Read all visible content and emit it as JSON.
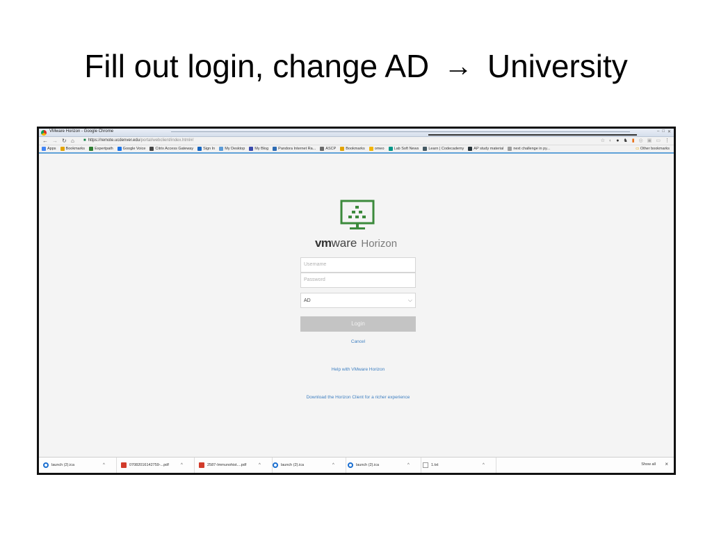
{
  "slide": {
    "title_before": "Fill out login, change AD",
    "title_arrow": "→",
    "title_after": "University"
  },
  "browser": {
    "window_title": "VMware Horizon - Google Chrome",
    "url_host": "https://remote.ucdenver.edu",
    "url_path": "/portal/webclient/index.html#/",
    "bookmarks": [
      {
        "label": "Apps",
        "color": "#4285f4"
      },
      {
        "label": "Bookmarks",
        "color": "#e2a300"
      },
      {
        "label": "Expertpath",
        "color": "#2e7d32"
      },
      {
        "label": "Google Voice",
        "color": "#1a73e8"
      },
      {
        "label": "Citrix Access Gateway",
        "color": "#444444"
      },
      {
        "label": "Sign In",
        "color": "#1565c0"
      },
      {
        "label": "My Desktop",
        "color": "#5c9bd6"
      },
      {
        "label": "My Blog",
        "color": "#3949ab"
      },
      {
        "label": "Pandora Internet Ra...",
        "color": "#2c6bb3"
      },
      {
        "label": "ASCP",
        "color": "#6a6a6a"
      },
      {
        "label": "Bookmarks",
        "color": "#e2a300"
      },
      {
        "label": "omeo",
        "color": "#f2b400"
      },
      {
        "label": "Lab Soft News",
        "color": "#009688"
      },
      {
        "label": "Learn | Codecademy",
        "color": "#455a64"
      },
      {
        "label": "AP study material",
        "color": "#263238"
      },
      {
        "label": "next challenge in py...",
        "color": "#9e9e9e"
      }
    ],
    "other_bookmarks": "Other bookmarks"
  },
  "login": {
    "brand_vm": "vm",
    "brand_ware": "ware",
    "brand_product": "Horizon",
    "username_placeholder": "Username",
    "password_placeholder": "Password",
    "domain_value": "AD",
    "login_label": "Login",
    "cancel_label": "Cancel",
    "help_label": "Help with VMware Horizon",
    "download_label": "Download the Horizon Client for a richer experience",
    "logo_color": "#3c8a3c"
  },
  "downloads": {
    "items": [
      {
        "name": "launch (2).ica",
        "type": "ica"
      },
      {
        "name": "07082016142759-...pdf",
        "type": "pdf"
      },
      {
        "name": "2587-Immunohist....pdf",
        "type": "pdf"
      },
      {
        "name": "launch (2).ica",
        "type": "ica"
      },
      {
        "name": "launch (2).ica",
        "type": "ica"
      },
      {
        "name": "1.txt",
        "type": "txt"
      }
    ],
    "show_all": "Show all",
    "close": "×"
  }
}
